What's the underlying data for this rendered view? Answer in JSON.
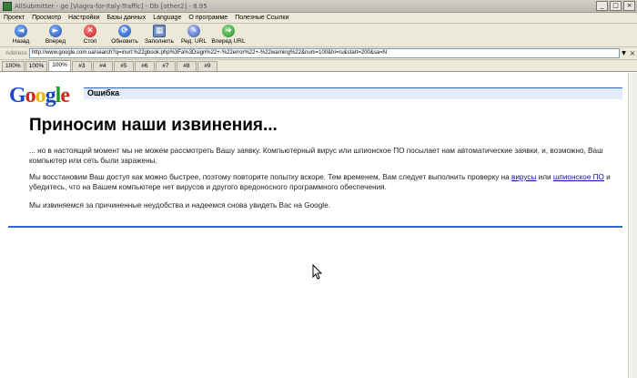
{
  "window": {
    "title": "AllSubmitter - ge [Viagra-for-Italy-Traffic] - Db [other2] - 8.95",
    "minimize_glyph": "_",
    "maximize_glyph": "□",
    "close_glyph": "×"
  },
  "menu": [
    "Проект",
    "Просмотр",
    "Настройки",
    "Базы данных",
    "Language",
    "О программе",
    "Полезные Ссылки"
  ],
  "toolbar": {
    "buttons": [
      {
        "label": "Назад",
        "icon": "back-arrow-icon",
        "glyph": "◄"
      },
      {
        "label": "Вперед",
        "icon": "forward-arrow-icon",
        "glyph": "►"
      },
      {
        "label": "Стоп",
        "icon": "stop-icon",
        "glyph": "✕"
      },
      {
        "label": "Обновить",
        "icon": "refresh-icon",
        "glyph": "⟳"
      },
      {
        "label": "Заполнить",
        "icon": "fill-form-icon",
        "glyph": "▦"
      },
      {
        "label": "Ред. URL",
        "icon": "edit-url-icon",
        "glyph": "✎"
      },
      {
        "label": "Вперед URL",
        "icon": "next-url-icon",
        "glyph": "➜"
      }
    ]
  },
  "address": {
    "label": "Address",
    "value": "http://www.google.com.ua/search?q=inurl:%22gbook.php%3Fa%3Dsign%22+-%22error%22+-%22warning%22&num=100&hl=ru&start=200&sa=N",
    "dropdown_glyph": "▼",
    "close_glyph": "×"
  },
  "tabs": [
    "100%",
    "100%",
    "100%",
    "#3",
    "#4",
    "#5",
    "#6",
    "#7",
    "#8",
    "#9"
  ],
  "active_tab_index": 2,
  "page": {
    "logo": [
      "G",
      "o",
      "o",
      "g",
      "l",
      "e"
    ],
    "error_title": "Ошибка",
    "heading": "Приносим наши извинения...",
    "p1": "... но в настоящий момент мы не можем рассмотреть Вашу заявку. Компьютерный вирус или шпионское ПО посылает нам автоматические заявки, и, возможно, Ваш компьютер или сеть были заражены.",
    "p2_before": "Мы восстановим Ваш доступ как можно быстрее, поэтому повторите попытку вскоре. Тем временем, Вам следует выполнить проверку на ",
    "p2_link1": "вирусы",
    "p2_mid": " или ",
    "p2_link2": "шпионское ПО",
    "p2_after": " и убедитесь, что на Вашем компьютере нет вирусов и другого вредоносного программного обеспечения.",
    "p3": "Мы извиняемся за причиненные неудобства и надеемся снова увидеть Вас на Google."
  },
  "colors": {
    "google_blue": "#1a48c4",
    "google_red": "#d2271c",
    "google_yellow": "#e8b90c",
    "google_green": "#1b9a2c",
    "rule_blue": "#3366cc",
    "error_bar_bg": "#e5ecf9",
    "link": "#1a0dab"
  }
}
